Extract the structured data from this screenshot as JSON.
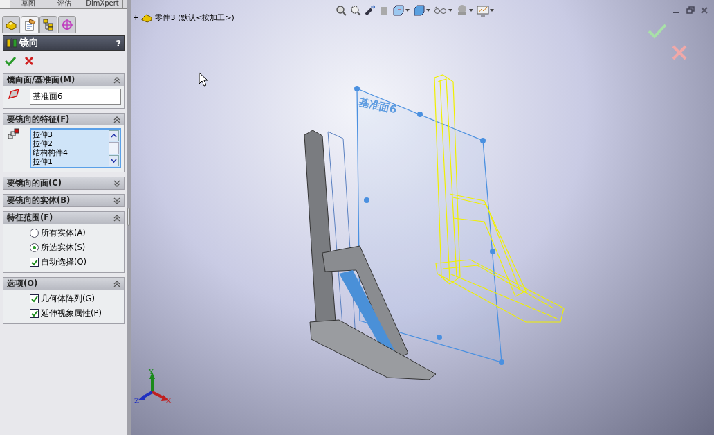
{
  "top_tabs": [
    {
      "label": "草图"
    },
    {
      "label": "评估"
    },
    {
      "label": "DimXpert"
    }
  ],
  "panel_tabs": [
    {
      "kind": "feature",
      "selected": false
    },
    {
      "kind": "property",
      "selected": true
    },
    {
      "kind": "configuration",
      "selected": false
    },
    {
      "kind": "dimxpert",
      "selected": false
    }
  ],
  "property_manager": {
    "title": "镜向",
    "help": "?"
  },
  "sections": [
    {
      "kind": "face-select",
      "title": "镜向面/基准面(M)",
      "expanded": true,
      "value": "基准面6"
    },
    {
      "kind": "list",
      "title": "要镜向的特征(F)",
      "expanded": true,
      "items": [
        "拉伸3",
        "拉伸2",
        "结构构件4",
        "拉伸1"
      ]
    },
    {
      "title": "要镜向的面(C)",
      "expanded": false
    },
    {
      "title": "要镜向的实体(B)",
      "expanded": false
    },
    {
      "kind": "options",
      "title": "特征范围(F)",
      "expanded": true,
      "options": [
        {
          "kind": "radio",
          "label": "所有实体(A)",
          "selected": false
        },
        {
          "kind": "radio",
          "label": "所选实体(S)",
          "selected": true
        },
        {
          "kind": "checkbox",
          "label": "自动选择(O)",
          "checked": true
        }
      ]
    },
    {
      "kind": "options",
      "title": "选项(O)",
      "expanded": true,
      "options": [
        {
          "kind": "checkbox",
          "label": "几何体阵列(G)",
          "checked": true
        },
        {
          "kind": "checkbox",
          "label": "延伸视象属性(P)",
          "checked": true
        }
      ]
    }
  ],
  "viewport": {
    "tree_toggle": "+",
    "tree_item": "零件3 (默认<按加工>)",
    "plane_label": "基准面6",
    "triad": {
      "x": "X",
      "y": "Y",
      "z": "Z"
    }
  }
}
